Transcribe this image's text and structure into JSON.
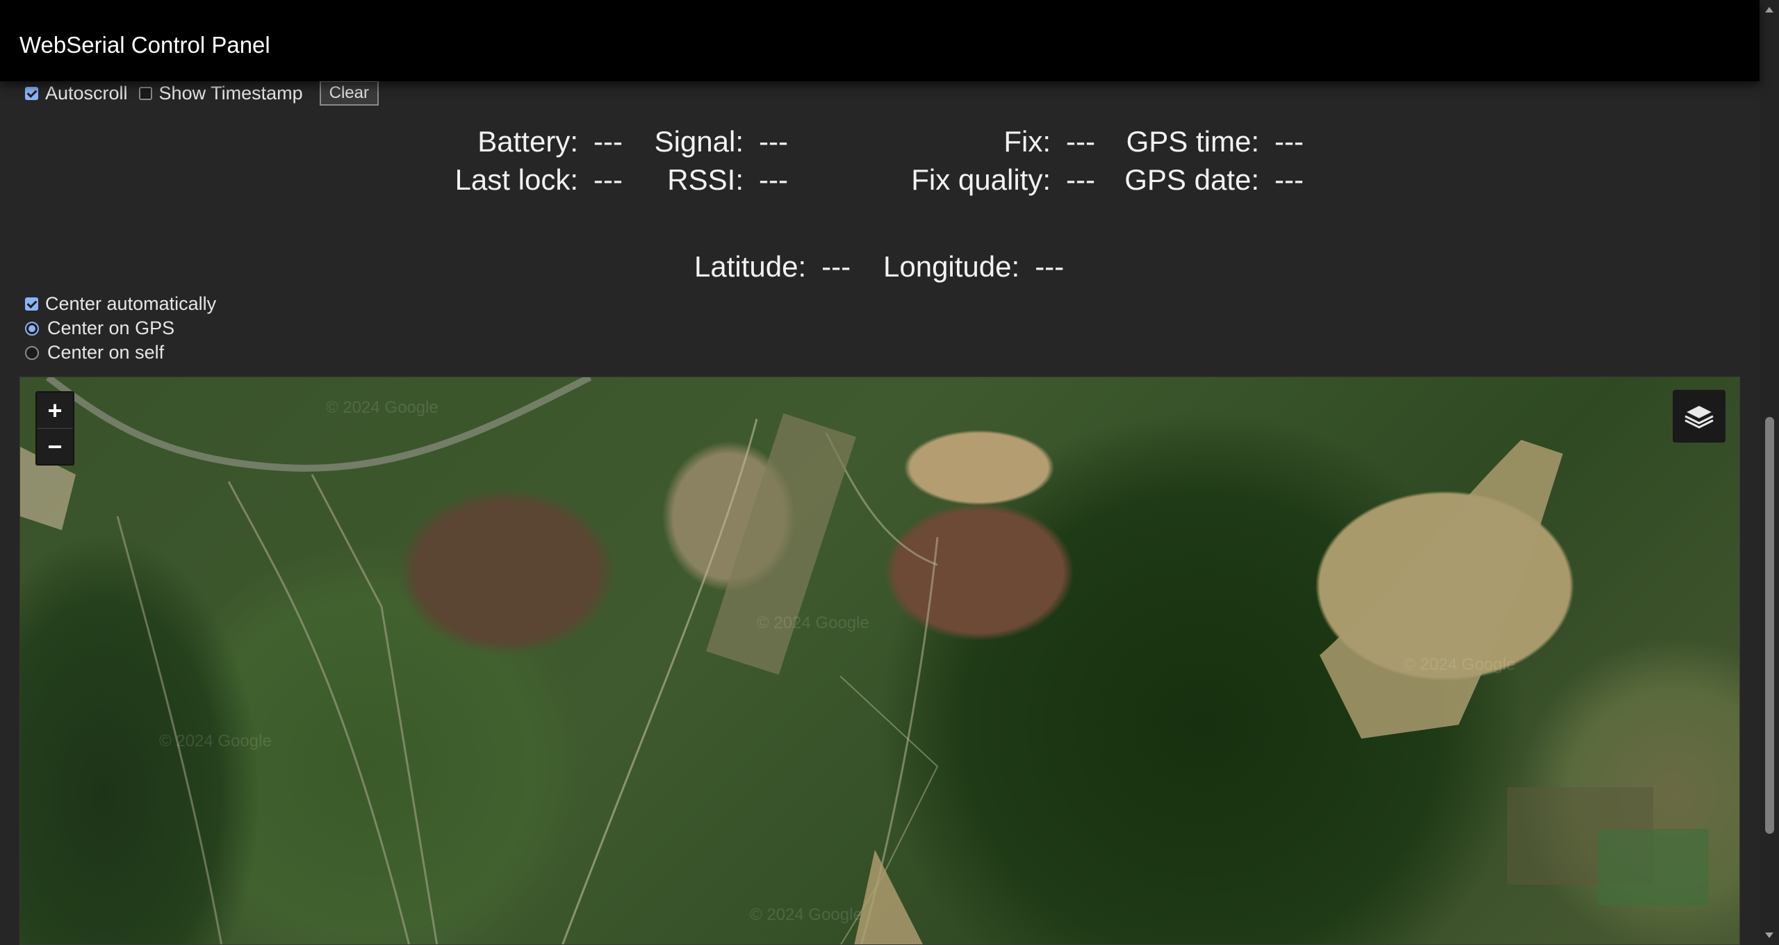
{
  "app": {
    "title": "WebSerial Control Panel"
  },
  "serial_options": {
    "autoscroll": {
      "label": "Autoscroll",
      "checked": true
    },
    "show_timestamp": {
      "label": "Show Timestamp",
      "checked": false
    },
    "clear_label": "Clear"
  },
  "status": {
    "battery": {
      "label": "Battery:",
      "value": "---"
    },
    "last_lock": {
      "label": "Last lock:",
      "value": "---"
    },
    "signal": {
      "label": "Signal:",
      "value": "---"
    },
    "rssi": {
      "label": "RSSI:",
      "value": "---"
    },
    "fix": {
      "label": "Fix:",
      "value": "---"
    },
    "fix_quality": {
      "label": "Fix quality:",
      "value": "---"
    },
    "gps_time": {
      "label": "GPS time:",
      "value": "---"
    },
    "gps_date": {
      "label": "GPS date:",
      "value": "---"
    },
    "latitude": {
      "label": "Latitude:",
      "value": "---"
    },
    "longitude": {
      "label": "Longitude:",
      "value": "---"
    }
  },
  "map_options": {
    "center_automatically": {
      "label": "Center automatically",
      "checked": true
    },
    "center_on_gps": {
      "label": "Center on GPS",
      "selected": true
    },
    "center_on_self": {
      "label": "Center on self",
      "selected": false
    }
  },
  "map": {
    "zoom_in_label": "+",
    "zoom_out_label": "−",
    "watermark": "© 2024 Google",
    "layers_icon": "layers-icon"
  },
  "colors": {
    "header_bg": "#000000",
    "page_bg": "#262626",
    "accent": "#8ab4f8"
  }
}
